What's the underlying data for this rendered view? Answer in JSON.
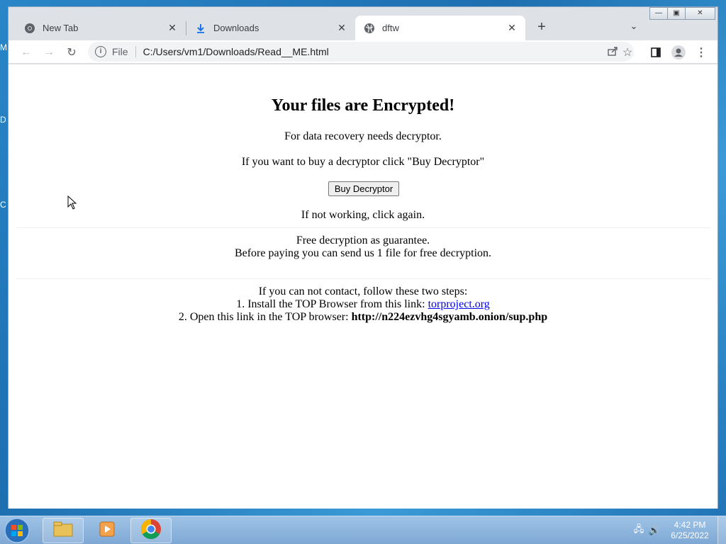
{
  "browser": {
    "tabs": [
      {
        "title": "New Tab",
        "icon": "chrome-icon"
      },
      {
        "title": "Downloads",
        "icon": "download-icon"
      },
      {
        "title": "dftw",
        "icon": "globe-icon"
      }
    ],
    "address": {
      "scheme": "File",
      "url": "C:/Users/vm1/Downloads/Read__ME.html"
    }
  },
  "page": {
    "heading": "Your files are Encrypted!",
    "recovery_text": "For data recovery needs decryptor.",
    "buy_instruction": "If you want to buy a decryptor click \"Buy Decryptor\"",
    "buy_button_label": "Buy Decryptor",
    "retry_text": "If not working, click again.",
    "guarantee_line1": "Free decryption as guarantee.",
    "guarantee_line2": "Before paying you can send us 1 file for free decryption.",
    "contact_intro": "If you can not contact, follow these two steps:",
    "step1_prefix": "1. Install the TOP Browser from this link: ",
    "step1_link": "torproject.org",
    "step2_prefix": "2. Open this link in the TOP browser: ",
    "step2_url": "http://n224ezvhg4sgyamb.onion/sup.php"
  },
  "taskbar": {
    "time": "4:42 PM",
    "date": "6/25/2022"
  }
}
